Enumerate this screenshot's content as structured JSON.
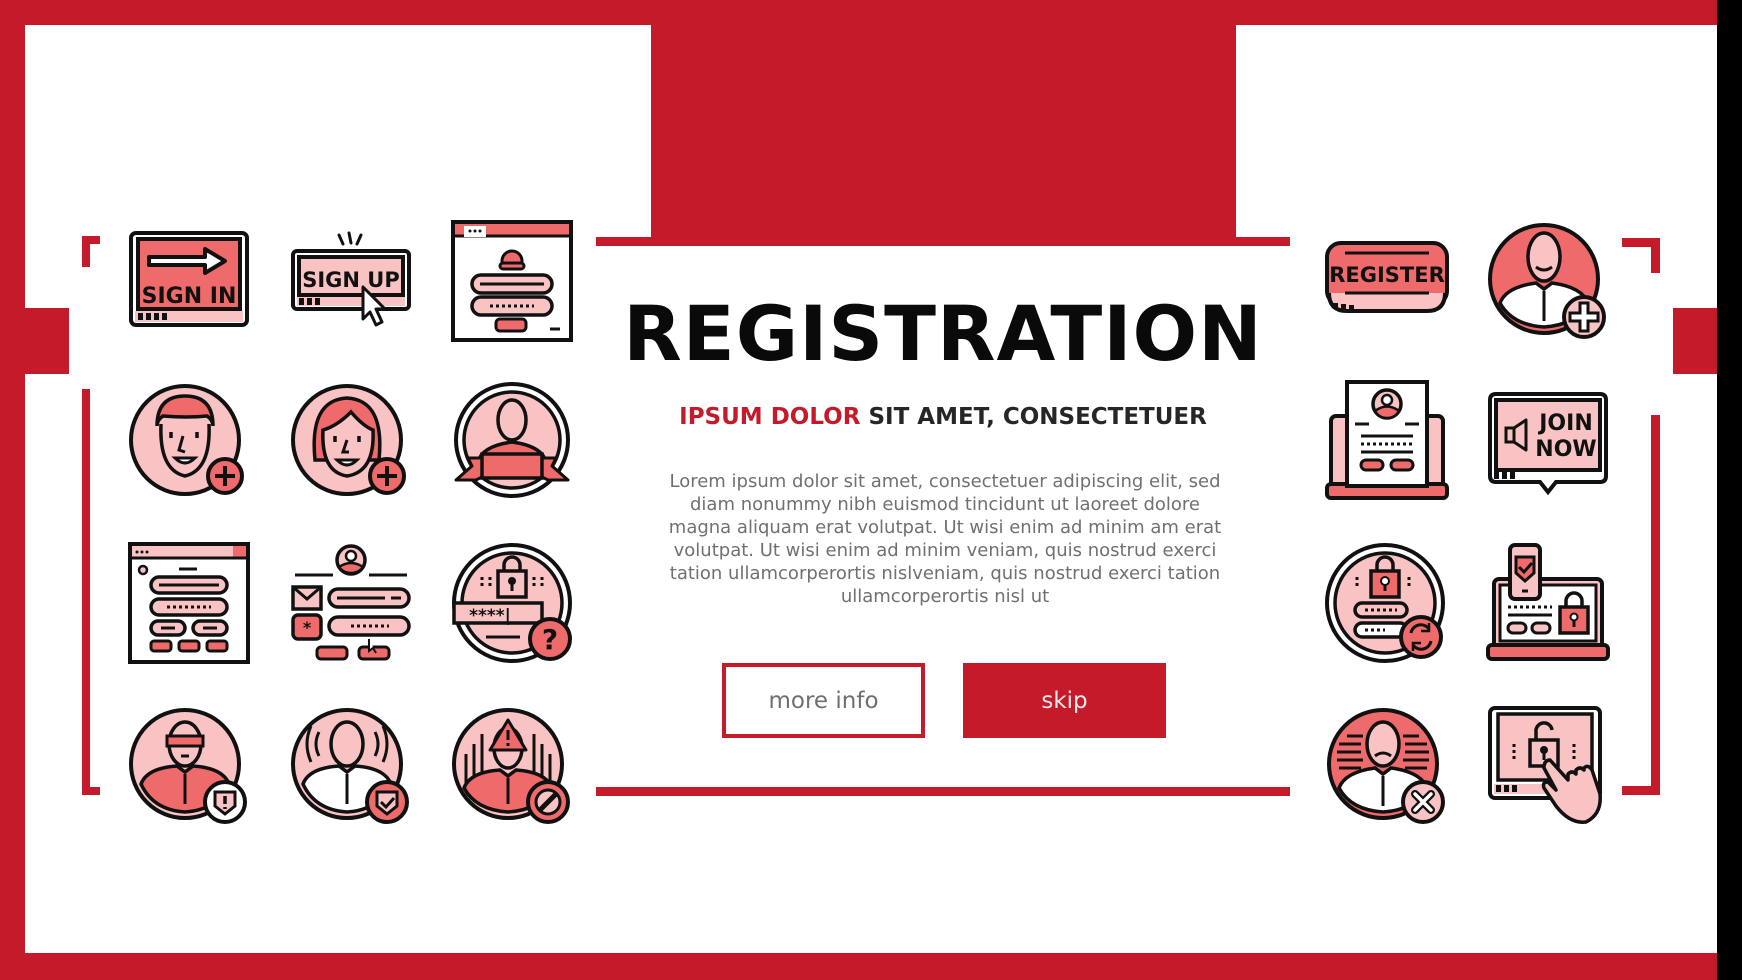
{
  "banner": {
    "title": "REGISTRATION",
    "subtitle_accent": "IPSUM DOLOR",
    "subtitle_rest": " SIT AMET, CONSECTETUER",
    "body_lines": [
      "Lorem ipsum dolor sit amet, consectetuer adipiscing elit, sed",
      "diam nonummy nibh euismod tincidunt ut laoreet dolore",
      "magna aliquam erat volutpat. Ut wisi enim ad minim am erat",
      "volutpat. Ut wisi enim ad minim veniam, quis nostrud exerci",
      "tation ullamcorperortis nislveniam, quis nostrud exerci tation",
      "ullamcorperortis nisl ut"
    ]
  },
  "buttons": {
    "more_info": "more info",
    "skip": "skip"
  },
  "colors": {
    "brand_red": "#c41a2a",
    "icon_red": "#ef6b6b",
    "icon_pink": "#f9c3c3",
    "outline": "#111111",
    "title": "#0a0a0a",
    "body_text": "#707070"
  },
  "icons": {
    "left": [
      {
        "name": "sign-in-sign-icon",
        "label": "SIGN IN"
      },
      {
        "name": "sign-up-button-icon",
        "label": "SIGN UP"
      },
      {
        "name": "login-window-icon"
      },
      {
        "name": "add-male-user-icon"
      },
      {
        "name": "add-female-user-icon"
      },
      {
        "name": "user-badge-ribbon-icon"
      },
      {
        "name": "registration-form-window-icon"
      },
      {
        "name": "signup-form-icon"
      },
      {
        "name": "forgot-password-icon"
      },
      {
        "name": "user-warning-shield-icon"
      },
      {
        "name": "user-verified-shield-icon"
      },
      {
        "name": "user-blocked-icon"
      }
    ],
    "right": [
      {
        "name": "register-button-icon",
        "label": "REGISTER"
      },
      {
        "name": "add-user-icon"
      },
      {
        "name": "laptop-profile-form-icon"
      },
      {
        "name": "join-now-speech-icon",
        "label_line1": "JOIN",
        "label_line2": "NOW"
      },
      {
        "name": "password-reset-icon"
      },
      {
        "name": "laptop-two-factor-lock-icon"
      },
      {
        "name": "user-rejected-icon"
      },
      {
        "name": "tablet-unlock-touch-icon"
      }
    ]
  }
}
